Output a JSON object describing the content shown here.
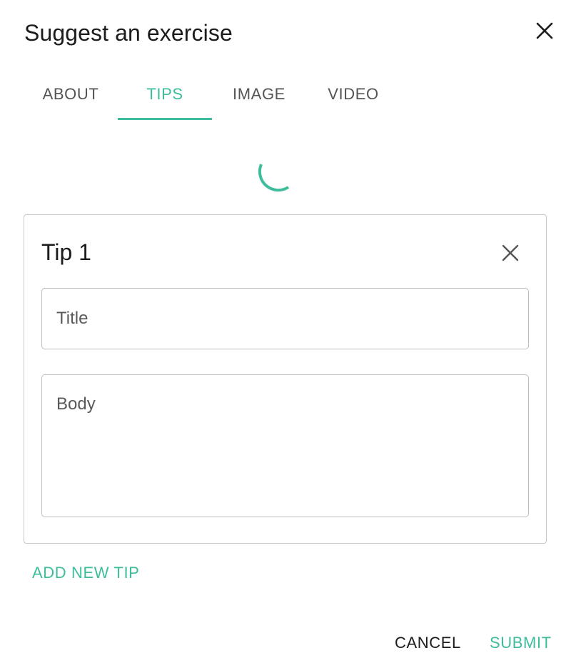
{
  "dialog": {
    "title": "Suggest an exercise",
    "close_icon": "close-icon"
  },
  "tabs": [
    {
      "label": "ABOUT",
      "active": false
    },
    {
      "label": "TIPS",
      "active": true
    },
    {
      "label": "IMAGE",
      "active": false
    },
    {
      "label": "VIDEO",
      "active": false
    }
  ],
  "loading": {
    "icon": "spinner-icon"
  },
  "tip": {
    "heading": "Tip 1",
    "remove_icon": "close-icon",
    "title_placeholder": "Title",
    "body_placeholder": "Body"
  },
  "actions": {
    "add_tip": "ADD NEW TIP",
    "cancel": "CANCEL",
    "submit": "SUBMIT"
  },
  "colors": {
    "accent": "#3dbd9c",
    "text": "#1c1c1c",
    "muted": "#555555",
    "border": "#c8c8c8"
  }
}
